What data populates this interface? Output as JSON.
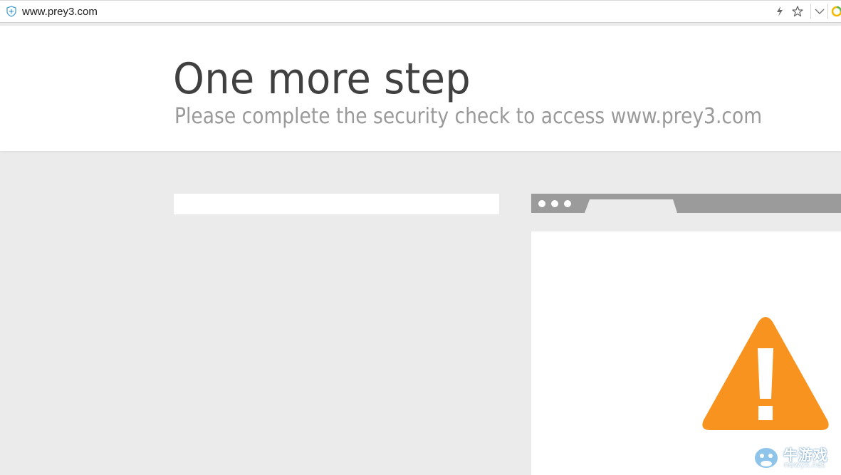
{
  "browser": {
    "url": "www.prey3.com",
    "icons": [
      "shield-icon",
      "lightning-icon",
      "star-icon",
      "chevron-down-icon",
      "extension-ring-icon"
    ]
  },
  "header": {
    "title": "One more step",
    "subtitle": "Please complete the security check to access www.prey3.com"
  },
  "illustration": {
    "icon": "warning-triangle-icon",
    "accent_color": "#f7931e"
  },
  "watermark": {
    "text": "牛游戏",
    "sub": "newyx.net"
  },
  "colors": {
    "background": "#ebebeb",
    "title": "#404040",
    "subtitle": "#9a9a9a",
    "chrome": "#9b9b9b"
  }
}
